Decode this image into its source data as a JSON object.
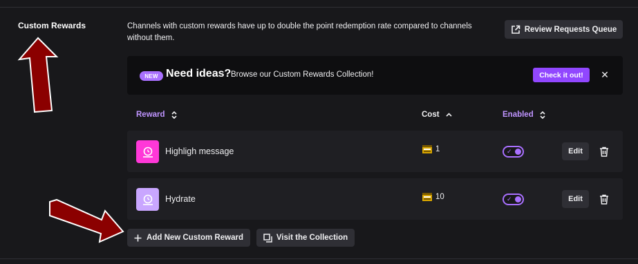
{
  "section": {
    "title": "Custom Rewards",
    "description": "Channels with custom rewards have up to double the point redemption rate compared to channels without them."
  },
  "review_button": {
    "label": "Review Requests Queue",
    "icon": "external-link-icon"
  },
  "banner": {
    "badge": "NEW",
    "heading": "Need ideas?",
    "text": "Browse our Custom Rewards Collection!",
    "cta": "Check it out!",
    "close": "✕"
  },
  "table": {
    "columns": {
      "reward": "Reward",
      "cost": "Cost",
      "enabled": "Enabled"
    },
    "rows": [
      {
        "name": "Highligh message",
        "cost": "1",
        "enabled": true,
        "icon_color": "#ff38d8",
        "edit": "Edit"
      },
      {
        "name": "Hydrate",
        "cost": "10",
        "enabled": true,
        "icon_color": "#c9a6ff",
        "edit": "Edit"
      }
    ]
  },
  "actions": {
    "add": "Add New Custom Reward",
    "visit": "Visit the Collection"
  },
  "colors": {
    "accent": "#9147ff",
    "accent_light": "#bf94ff",
    "annotation_arrow": "#8b0000"
  }
}
